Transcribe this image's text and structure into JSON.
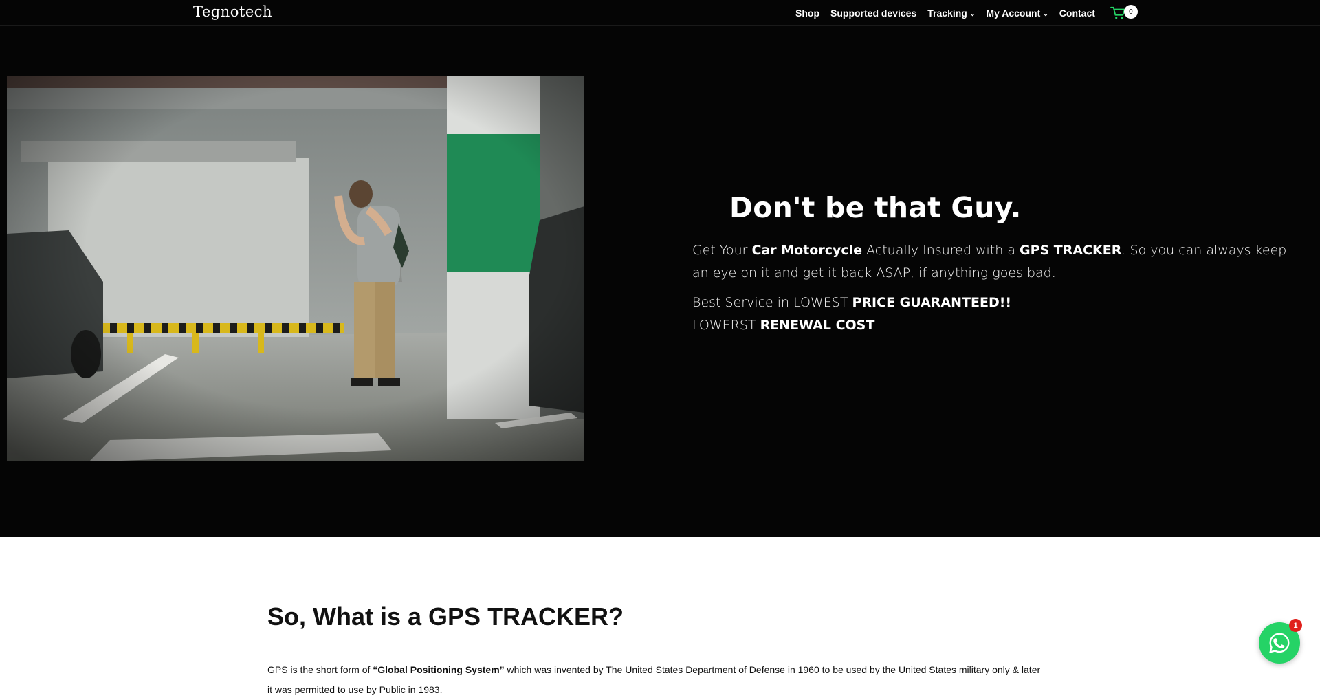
{
  "brand": {
    "logo": "Tegnotech"
  },
  "nav": {
    "shop": "Shop",
    "supported_devices": "Supported devices",
    "tracking": "Tracking",
    "my_account": "My Account",
    "contact": "Contact",
    "cart_count": "0"
  },
  "hero": {
    "image_icon": "parking-garage-photo",
    "title": "Don't be that Guy.",
    "p1": {
      "t1": "Get Your ",
      "b1": "Car Motorcycle",
      "t2": " Actually Insured with a ",
      "b2": "GPS TRACKER",
      "t3": ". So you can always keep an eye on it and get it back ASAP, if anything goes bad."
    },
    "p2": {
      "t1": "Best Service in LOWEST ",
      "b1": "PRICE GUARANTEED!!",
      "t2": "LOWERST ",
      "b2": "RENEWAL COST"
    }
  },
  "section": {
    "heading": "So, What is a GPS TRACKER?",
    "para": {
      "t1": "GPS is the short form of ",
      "b1": "“Global Positioning System”",
      "t2": " which was invented by The United States Department of Defense in 1960 to be used by the United States military only & later it was permitted to use by Public in 1983."
    }
  },
  "whatsapp": {
    "badge": "1",
    "icon": "whatsapp-icon"
  },
  "colors": {
    "accent": "#25d366",
    "hero_bg": "#050505",
    "badge_red": "#e0201b"
  }
}
